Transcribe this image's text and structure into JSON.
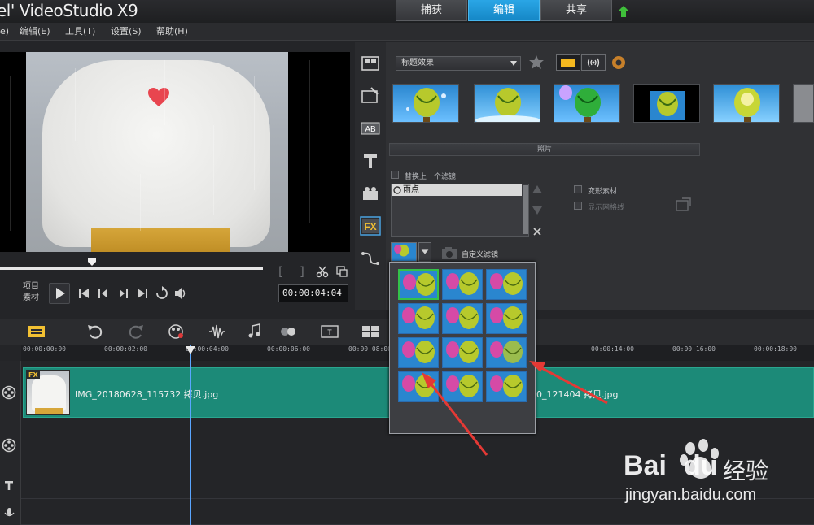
{
  "title": "el' VideoStudio X9",
  "mode_tabs": [
    "捕获",
    "编辑",
    "共享"
  ],
  "menu": [
    "e)",
    "编辑(E)",
    "工具(T)",
    "设置(S)",
    "帮助(H)"
  ],
  "preview": {
    "mode_project": "项目",
    "mode_clip": "素材",
    "timecode": "00:00:04:04"
  },
  "library": {
    "dropdown": "标题效果",
    "section_label": "照片",
    "replace_last_filter": "替换上一个滤镜",
    "filter_name": "雨点",
    "custom_filter": "自定义滤镜",
    "morph_clip": "变形素材",
    "show_grid": "显示网格线"
  },
  "timeline": {
    "ruler": [
      "00:00:00:00",
      "00:00:02:00",
      "00:00:04:00",
      "00:00:06:00",
      "00:00:08:00",
      "00:00:14:00",
      "00:00:16:00",
      "00:00:18:00"
    ],
    "clip1": "IMG_20180628_115732 拷贝.jpg",
    "clip1_badge": "FX",
    "clip2": "0_121404 拷贝.jpg"
  },
  "watermark": {
    "brand": "Bai",
    "brand2": "du",
    "suffix": "经验",
    "url": "jingyan.baidu.com"
  },
  "colors": {
    "accent": "#1587c6",
    "clip": "#1c8a78",
    "selected_preset": "#34c24a",
    "arrow": "#e53935"
  }
}
